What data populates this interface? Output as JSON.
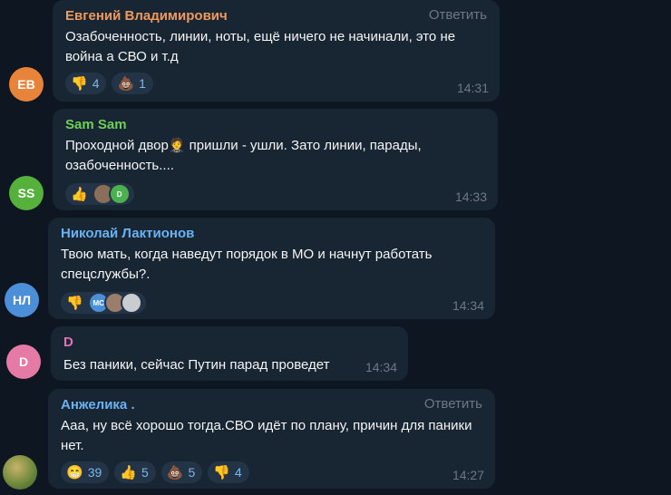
{
  "messages": [
    {
      "author": "Евгений Владимирович",
      "author_color": "#f09a5c",
      "reply_label": "Ответить",
      "text": "Озабоченность, линии, ноты, ещё ничего не начинали, это не война а СВО и т.д",
      "time": "14:31",
      "avatar_initials": "ЕВ",
      "avatar_color": "#e8833a",
      "reactions": [
        {
          "emoji": "👎",
          "count": "4"
        },
        {
          "emoji": "💩",
          "count": "1"
        }
      ]
    },
    {
      "author": "Sam Sam",
      "author_color": "#6fcf57",
      "text_before": "Проходной двор",
      "text_emoji": "🤵",
      "text_after": " пришли - ушли. Зато линии, парады, озабоченность....",
      "time": "14:33",
      "avatar_initials": "SS",
      "avatar_color": "#55b03c",
      "reaction_emoji": "👍",
      "reactor_initial": "D",
      "reactor_color": "#4caf50"
    },
    {
      "author": "Николай Лактионов",
      "author_color": "#6ab2f2",
      "text": "Твою мать, когда наведут порядок в МО и начнут работать спецслужбы?.",
      "time": "14:34",
      "avatar_initials": "НЛ",
      "avatar_color": "#4b8fd9",
      "reaction_emoji": "👎",
      "reactor_initial": "МС",
      "reactor_color": "#4b8fd9"
    },
    {
      "author": "D",
      "author_color": "#e56fb5",
      "text": "Без паники, сейчас Путин парад проведет",
      "time": "14:34",
      "avatar_initials": "D",
      "avatar_color": "#e57aa6"
    },
    {
      "author": "Анжелика .",
      "author_color": "#6ab2f2",
      "reply_label": "Ответить",
      "text": "Ааа, ну всё хорошо тогда.СВО идёт по плану, причин для паники нет.",
      "time": "14:27",
      "reactions": [
        {
          "emoji": "😁",
          "count": "39"
        },
        {
          "emoji": "👍",
          "count": "5"
        },
        {
          "emoji": "💩",
          "count": "5"
        },
        {
          "emoji": "👎",
          "count": "4"
        }
      ]
    }
  ]
}
